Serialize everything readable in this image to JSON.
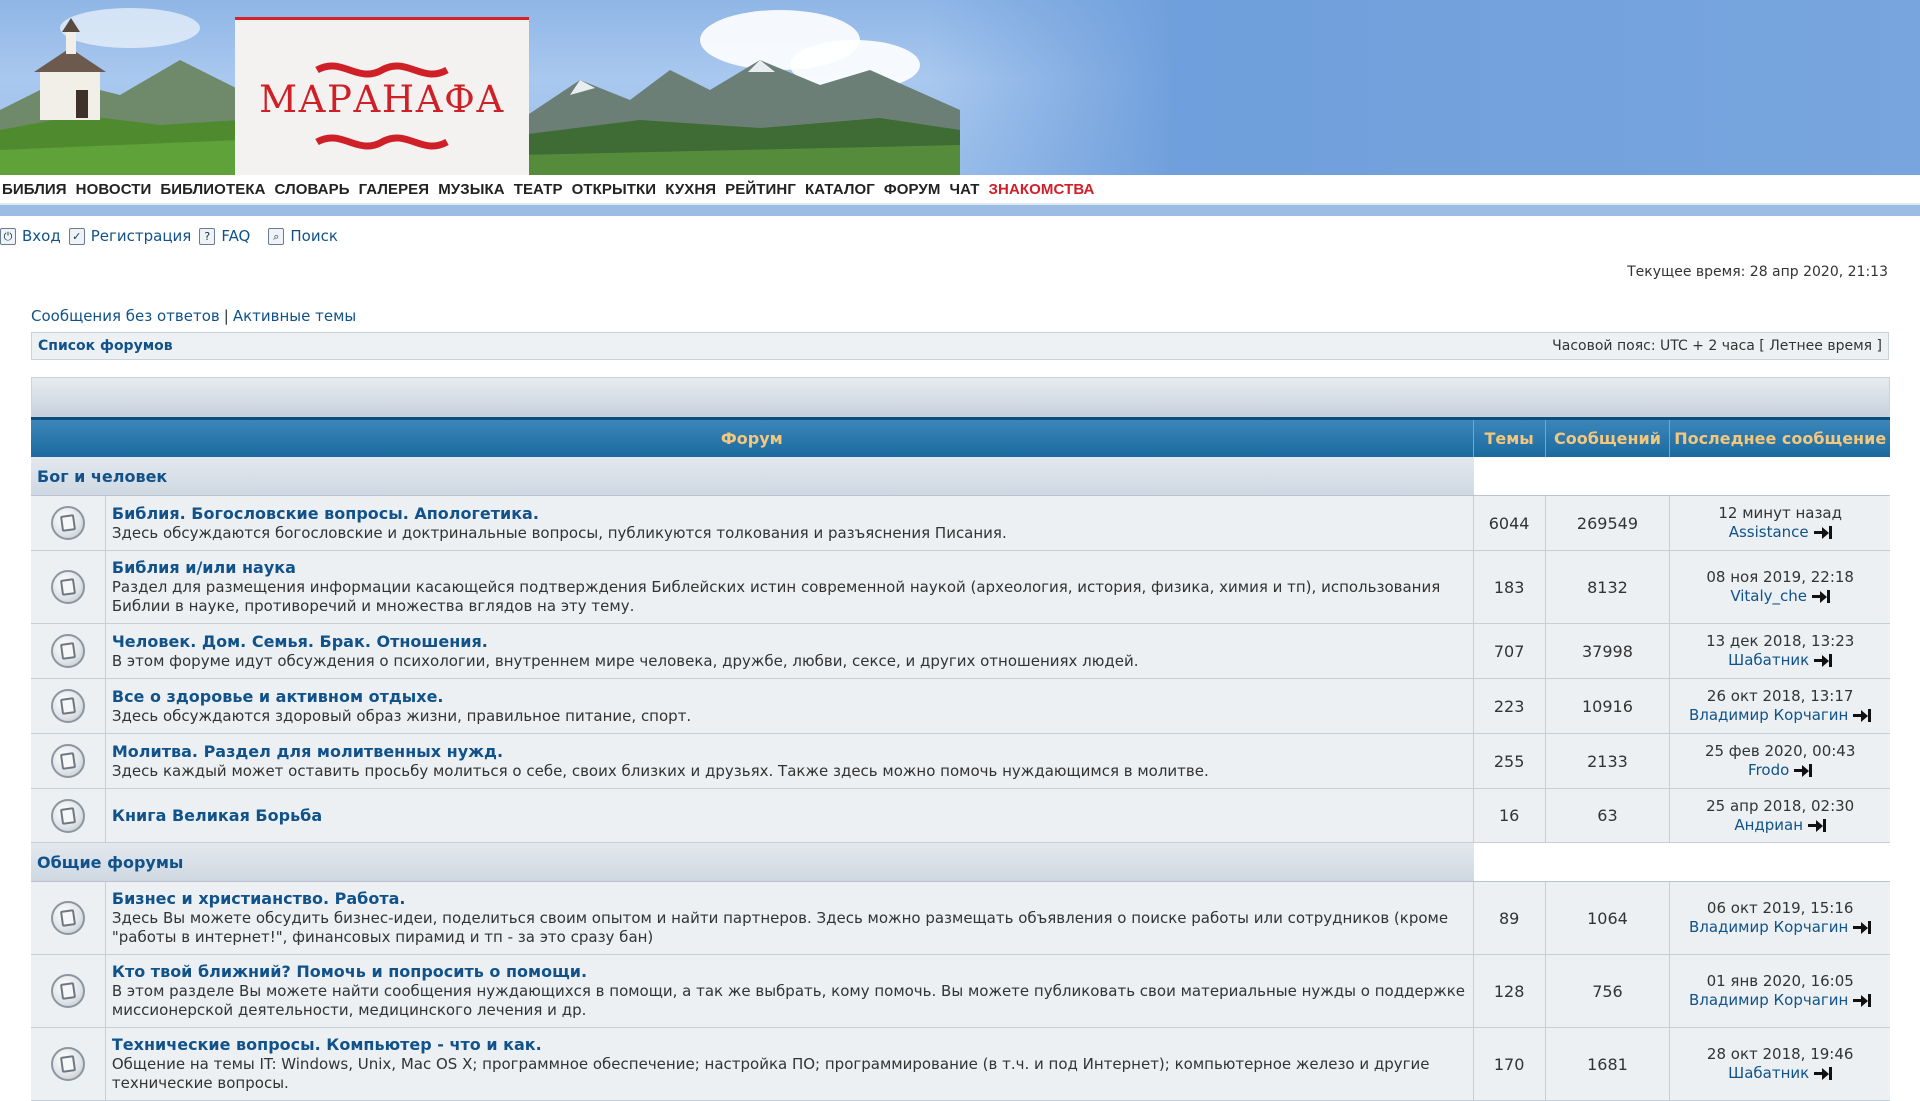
{
  "header": {
    "logo_text": "МАРАНАФА"
  },
  "topmenu": {
    "items": [
      "БИБЛИЯ",
      "НОВОСТИ",
      "БИБЛИОТЕКА",
      "СЛОВАРЬ",
      "ГАЛЕРЕЯ",
      "МУЗЫКА",
      "ТЕАТР",
      "ОТКРЫТКИ",
      "КУХНЯ",
      "РЕЙТИНГ",
      "КАТАЛОГ",
      "ФОРУМ",
      "ЧАТ"
    ],
    "highlight": "ЗНАКОМСТВА",
    "highlight_color": "#d0202a"
  },
  "userlinks": {
    "login": "Вход",
    "register": "Регистрация",
    "faq": "FAQ",
    "search": "Поиск"
  },
  "current_time": "Текущее время: 28 апр 2020, 21:13",
  "searchlinks": {
    "unanswered": "Сообщения без ответов",
    "separator": "|",
    "active": "Активные темы"
  },
  "navbar": {
    "crumb": "Список форумов",
    "timezone": "Часовой пояс: UTC + 2 часа [ Летнее время ]"
  },
  "table": {
    "headers": {
      "forum": "Форум",
      "topics": "Темы",
      "posts": "Сообщений",
      "last": "Последнее сообщение"
    },
    "categories": [
      {
        "title": "Бог и человек",
        "forums": [
          {
            "title": "Библия. Богословские вопросы. Апологетика.",
            "desc": "Здесь обсуждаются богословские и доктринальные вопросы, публикуются толкования и разъяснения Писания.",
            "topics": "6044",
            "posts": "269549",
            "last_time": "12 минут назад",
            "last_user": "Assistance"
          },
          {
            "title": "Библия и/или наука",
            "desc": "Раздел для размещения информации касающейся подтверждения Библейских истин современной наукой (археология, история, физика, химия и тп), использования Библии в науке, противоречий и множества вглядов на эту тему.",
            "topics": "183",
            "posts": "8132",
            "last_time": "08 ноя 2019, 22:18",
            "last_user": "Vitaly_che"
          },
          {
            "title": "Человек. Дом. Семья. Брак. Отношения.",
            "desc": "В этом форуме идут обсуждения о психологии, внутреннем мире человека, дружбе, любви, сексе, и других отношениях людей.",
            "topics": "707",
            "posts": "37998",
            "last_time": "13 дек 2018, 13:23",
            "last_user": "Шабатник"
          },
          {
            "title": "Все о здоровье и активном отдыхе.",
            "desc": "Здесь обсуждаются здоровый образ жизни, правильное питание, спорт.",
            "topics": "223",
            "posts": "10916",
            "last_time": "26 окт 2018, 13:17",
            "last_user": "Владимир Корчагин"
          },
          {
            "title": "Молитва. Раздел для молитвенных нужд.",
            "desc": "Здесь каждый может оставить просьбу молиться о себе, своих близких и друзьях. Также здесь можно помочь нуждающимся в молитве.",
            "topics": "255",
            "posts": "2133",
            "last_time": "25 фев 2020, 00:43",
            "last_user": "Frodo"
          },
          {
            "title": "Книга Великая Борьба",
            "desc": "",
            "topics": "16",
            "posts": "63",
            "last_time": "25 апр 2018, 02:30",
            "last_user": "Андриан"
          }
        ]
      },
      {
        "title": "Общие форумы",
        "forums": [
          {
            "title": "Бизнес и христианство. Работа.",
            "desc": "Здесь Вы можете обсудить бизнес-идеи, поделиться своим опытом и найти партнеров. Здесь можно размещать объявления о поиске работы или сотрудников (кроме \"работы в интернет!\", финансовых пирамид и тп - за это сразу бан)",
            "topics": "89",
            "posts": "1064",
            "last_time": "06 окт 2019, 15:16",
            "last_user": "Владимир Корчагин"
          },
          {
            "title": "Кто твой ближний? Помочь и попросить о помощи.",
            "desc": "В этом разделе Вы можете найти сообщения нуждающихся в помощи, а так же выбрать, кому помочь. Вы можете публиковать свои материальные нужды о поддержке миссионерской деятельности, медицинского лечения и др.",
            "topics": "128",
            "posts": "756",
            "last_time": "01 янв 2020, 16:05",
            "last_user": "Владимир Корчагин"
          },
          {
            "title": "Технические вопросы. Компьютер - что и как.",
            "desc": "Общение на темы IT: Windows, Unix, Mac OS X; программное обеспечение; настройка ПО; программирование (в т.ч. и под Интернет); компьютерное железо и другие технические вопросы.",
            "topics": "170",
            "posts": "1681",
            "last_time": "28 окт 2018, 19:46",
            "last_user": "Шабатник"
          }
        ]
      }
    ]
  },
  "colors": {
    "link": "#105289",
    "header_bg": "#1b6a9f",
    "header_text": "#f3c87d",
    "brand_red": "#cf2027"
  }
}
